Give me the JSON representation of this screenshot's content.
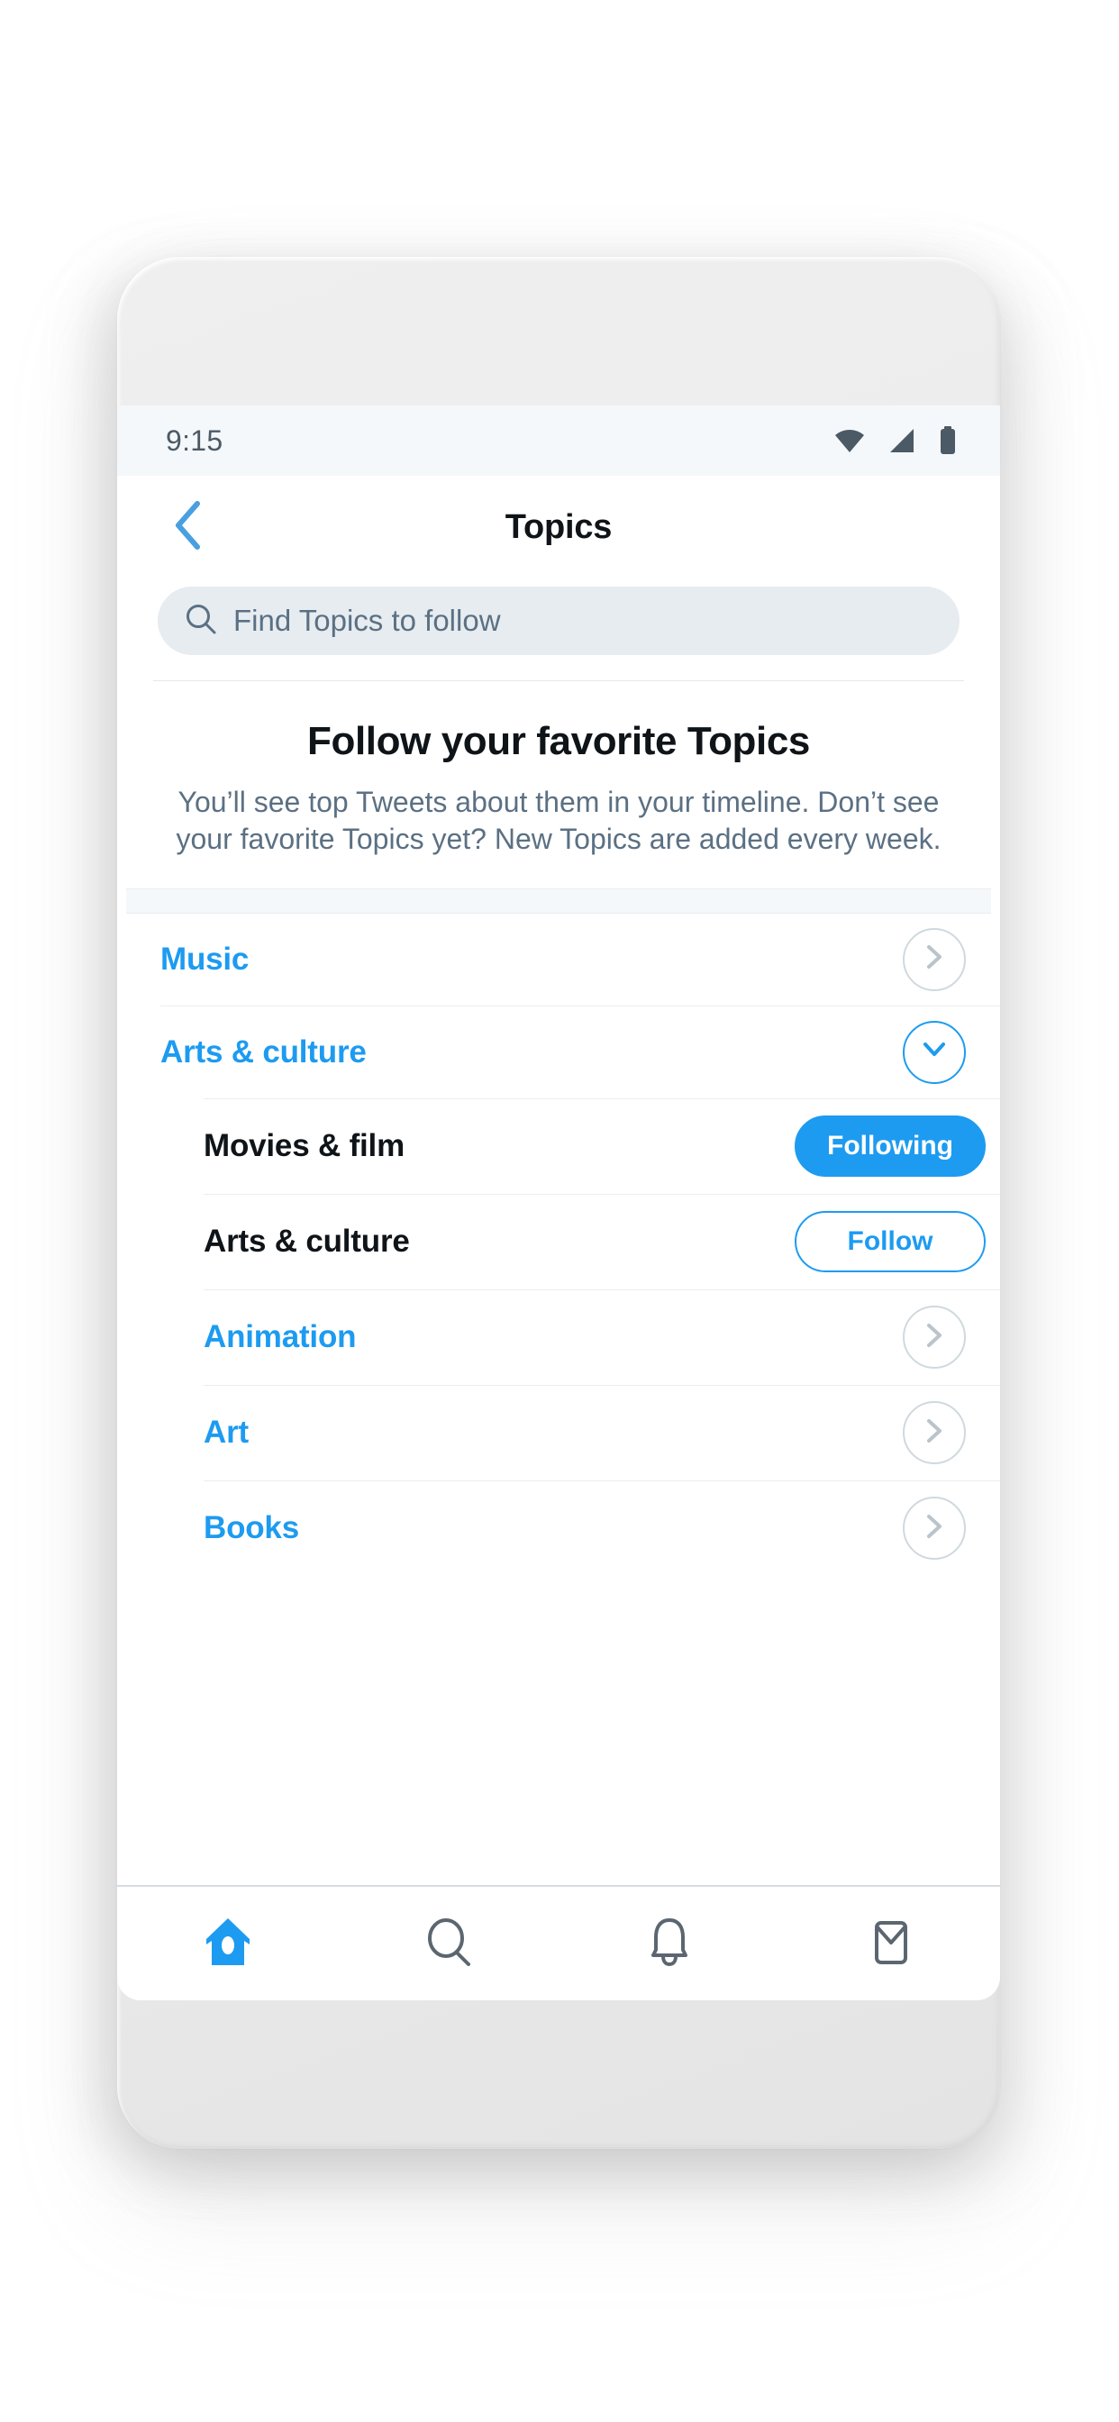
{
  "status_bar": {
    "time": "9:15",
    "icons": [
      "wifi-icon",
      "cellular-signal-icon",
      "battery-icon"
    ]
  },
  "header": {
    "back_icon": "chevron-left-icon",
    "title": "Topics"
  },
  "search": {
    "icon": "search-icon",
    "placeholder": "Find Topics to follow",
    "value": ""
  },
  "hero": {
    "title": "Follow your favorite Topics",
    "subtitle": "You’ll see top Tweets about them in your timeline. Don’t see your favorite Topics yet? New Topics are added every week."
  },
  "topics": [
    {
      "label": "Music",
      "level": "top",
      "style": "link",
      "control": "chevron-right",
      "expanded": false
    },
    {
      "label": "Arts & culture",
      "level": "top",
      "style": "link",
      "control": "chevron-down",
      "expanded": true
    },
    {
      "label": "Movies & film",
      "level": "sub",
      "style": "plain",
      "control": "pill-following",
      "button_label": "Following"
    },
    {
      "label": "Arts & culture",
      "level": "sub",
      "style": "plain",
      "control": "pill-follow",
      "button_label": "Follow"
    },
    {
      "label": "Animation",
      "level": "sub",
      "style": "link",
      "control": "chevron-right"
    },
    {
      "label": "Art",
      "level": "sub",
      "style": "link",
      "control": "chevron-right"
    },
    {
      "label": "Books",
      "level": "sub",
      "style": "link",
      "control": "chevron-right"
    }
  ],
  "bottom_nav": [
    {
      "name": "home",
      "icon": "home-icon",
      "active": true
    },
    {
      "name": "search",
      "icon": "search-icon",
      "active": false
    },
    {
      "name": "notifications",
      "icon": "bell-icon",
      "active": false
    },
    {
      "name": "messages",
      "icon": "envelope-icon",
      "active": false
    }
  ],
  "colors": {
    "accent": "#1d9bf0",
    "text_primary": "#0f1419",
    "text_secondary": "#5b7083",
    "divider": "#e9eef1",
    "search_bg": "#e6ecf0",
    "status_bg": "#f5f8fa"
  }
}
